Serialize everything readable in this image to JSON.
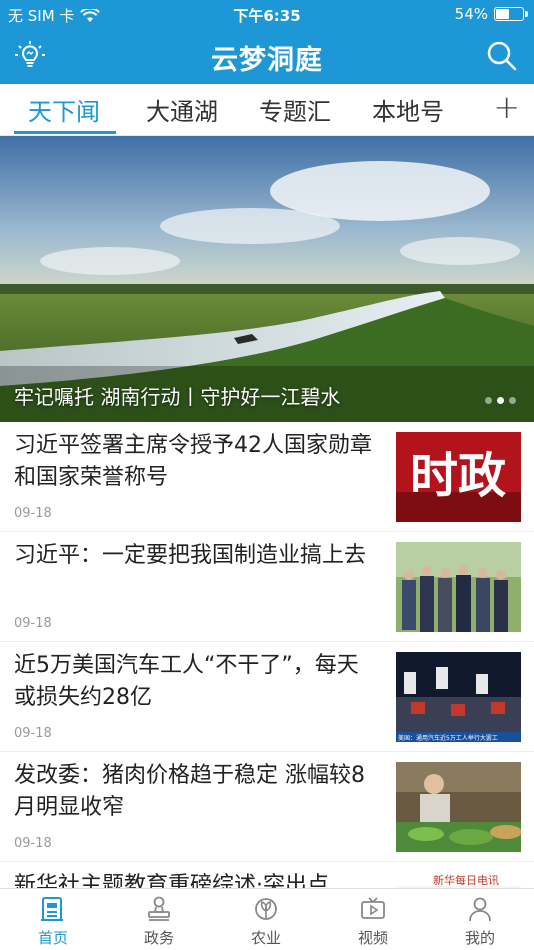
{
  "status_bar": {
    "carrier": "无 SIM 卡",
    "time": "下午6:35",
    "battery_text": "54%",
    "battery_level": 0.54
  },
  "header": {
    "title": "云梦洞庭",
    "accent_color": "#1e97d6"
  },
  "tabs": [
    {
      "label": "天下闻",
      "active": true
    },
    {
      "label": "大通湖",
      "active": false
    },
    {
      "label": "专题汇",
      "active": false
    },
    {
      "label": "本地号",
      "active": false
    }
  ],
  "tab_add_icon": "plus-icon",
  "banner": {
    "caption": "牢记嘱托 湖南行动丨守护好一江碧水",
    "active_dot": 2,
    "dot_count": 3
  },
  "news": [
    {
      "title": "习近平签署主席令授予42人国家勋章和国家荣誉称号",
      "date": "09-18",
      "thumb_text": "时政"
    },
    {
      "title": "习近平：一定要把我国制造业搞上去",
      "date": "09-18"
    },
    {
      "title": "近5万美国汽车工人“不干了”，每天或损失约28亿",
      "date": "09-18",
      "thumb_caption": "美国：通用汽车近5万工人举行大罢工"
    },
    {
      "title": "发改委：猪肉价格趋于稳定 涨幅较8月明显收窄",
      "date": "09-18"
    },
    {
      "title": "新华社主题教育重磅综述·突出点",
      "thumb_text": "新华每日电讯"
    }
  ],
  "bottom_nav": [
    {
      "label": "首页",
      "icon": "newspaper-icon",
      "active": true
    },
    {
      "label": "政务",
      "icon": "stamp-icon",
      "active": false
    },
    {
      "label": "农业",
      "icon": "leaf-icon",
      "active": false
    },
    {
      "label": "视频",
      "icon": "tv-icon",
      "active": false
    },
    {
      "label": "我的",
      "icon": "user-icon",
      "active": false
    }
  ]
}
